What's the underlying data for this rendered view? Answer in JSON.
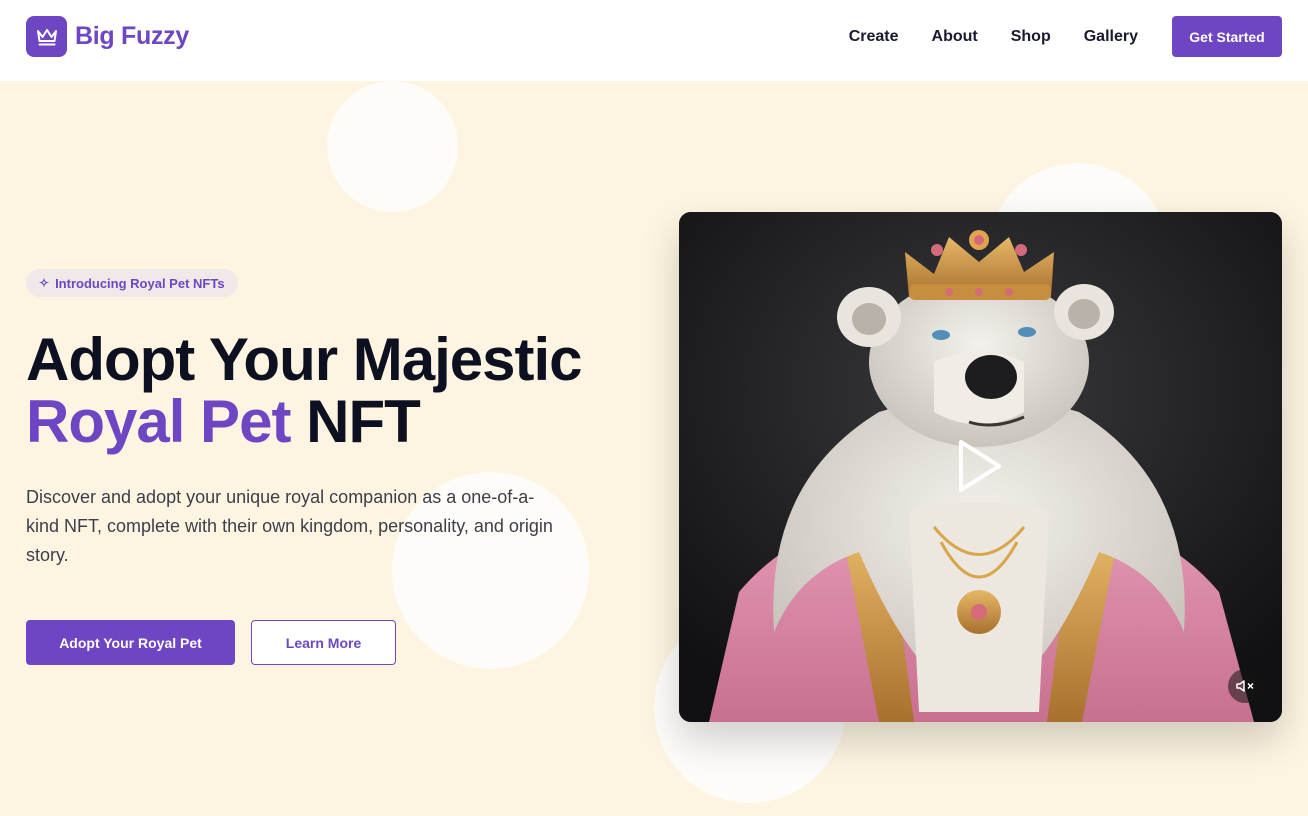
{
  "brand": {
    "name": "Big Fuzzy",
    "logo_icon": "crown-icon",
    "color": "#6e46c4"
  },
  "nav": {
    "links": [
      "Create",
      "About",
      "Shop",
      "Gallery"
    ],
    "cta_label": "Get Started"
  },
  "hero": {
    "badge": {
      "icon": "sparkles-icon",
      "label": "Introducing Royal Pet NFTs"
    },
    "headline_line1": "Adopt Your Majestic",
    "headline_accent": "Royal Pet",
    "headline_rest": "NFT",
    "description": "Discover and adopt your unique royal companion as a one-of-a-kind NFT, complete with their own kingdom, personality, and origin story.",
    "primary_button": "Adopt Your Royal Pet",
    "secondary_button": "Learn More",
    "background_color": "#fdf5e1",
    "video": {
      "subject": "polar bear wearing a crown and royal robe",
      "play_icon": "play-icon",
      "mute_icon": "muted-speaker-icon",
      "muted": true
    }
  }
}
